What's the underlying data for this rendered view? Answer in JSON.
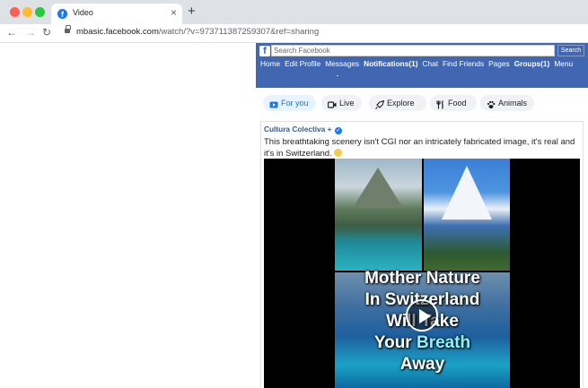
{
  "browser": {
    "tab_title": "Video",
    "tab_close": "×",
    "new_tab": "+",
    "url_host": "mbasic.facebook.com",
    "url_path": "/watch/?v=973711387259307&ref=sharing",
    "nav_back": "←",
    "nav_forward": "→",
    "nav_reload": "↻"
  },
  "facebook": {
    "search_placeholder": "Search Facebook",
    "search_button": "Search",
    "nav": [
      {
        "label": "Home",
        "bold": false
      },
      {
        "label": "Edit Profile",
        "bold": false
      },
      {
        "label": "Messages",
        "bold": false
      },
      {
        "label": "Notifications(1)",
        "bold": true
      },
      {
        "label": "Chat",
        "bold": false
      },
      {
        "label": "Find Friends",
        "bold": false
      },
      {
        "label": "Pages",
        "bold": false
      },
      {
        "label": "Groups(1)",
        "bold": true
      },
      {
        "label": "Menu",
        "bold": false
      }
    ],
    "chips": [
      {
        "label": "For you",
        "icon": "play-icon",
        "active": true
      },
      {
        "label": "Live",
        "icon": "live-video-icon",
        "active": false
      },
      {
        "label": "Explore",
        "icon": "rocket-icon",
        "active": false
      },
      {
        "label": "Food",
        "icon": "utensils-icon",
        "active": false
      },
      {
        "label": "Animals",
        "icon": "paw-icon",
        "active": false
      }
    ]
  },
  "post": {
    "author": "Cultura Colectiva",
    "author_suffix": "+",
    "text": "This breathtaking scenery isn't CGI nor an intricately fabricated image, it's real and it's in Switzerland.",
    "video_title_lines": [
      [
        {
          "t": "Mother Nature",
          "hl": false
        }
      ],
      [
        {
          "t": "In Switzerland",
          "hl": false
        }
      ],
      [
        {
          "t": "Will Take",
          "hl": false
        }
      ],
      [
        {
          "t": "Your ",
          "hl": false
        },
        {
          "t": "Breath",
          "hl": true
        }
      ],
      [
        {
          "t": "Away",
          "hl": false
        }
      ]
    ]
  },
  "colors": {
    "fb_blue": "#4267b2",
    "chip_active_bg": "#e7f3ff",
    "chip_active_text": "#1877f2",
    "author_link": "#385898"
  }
}
